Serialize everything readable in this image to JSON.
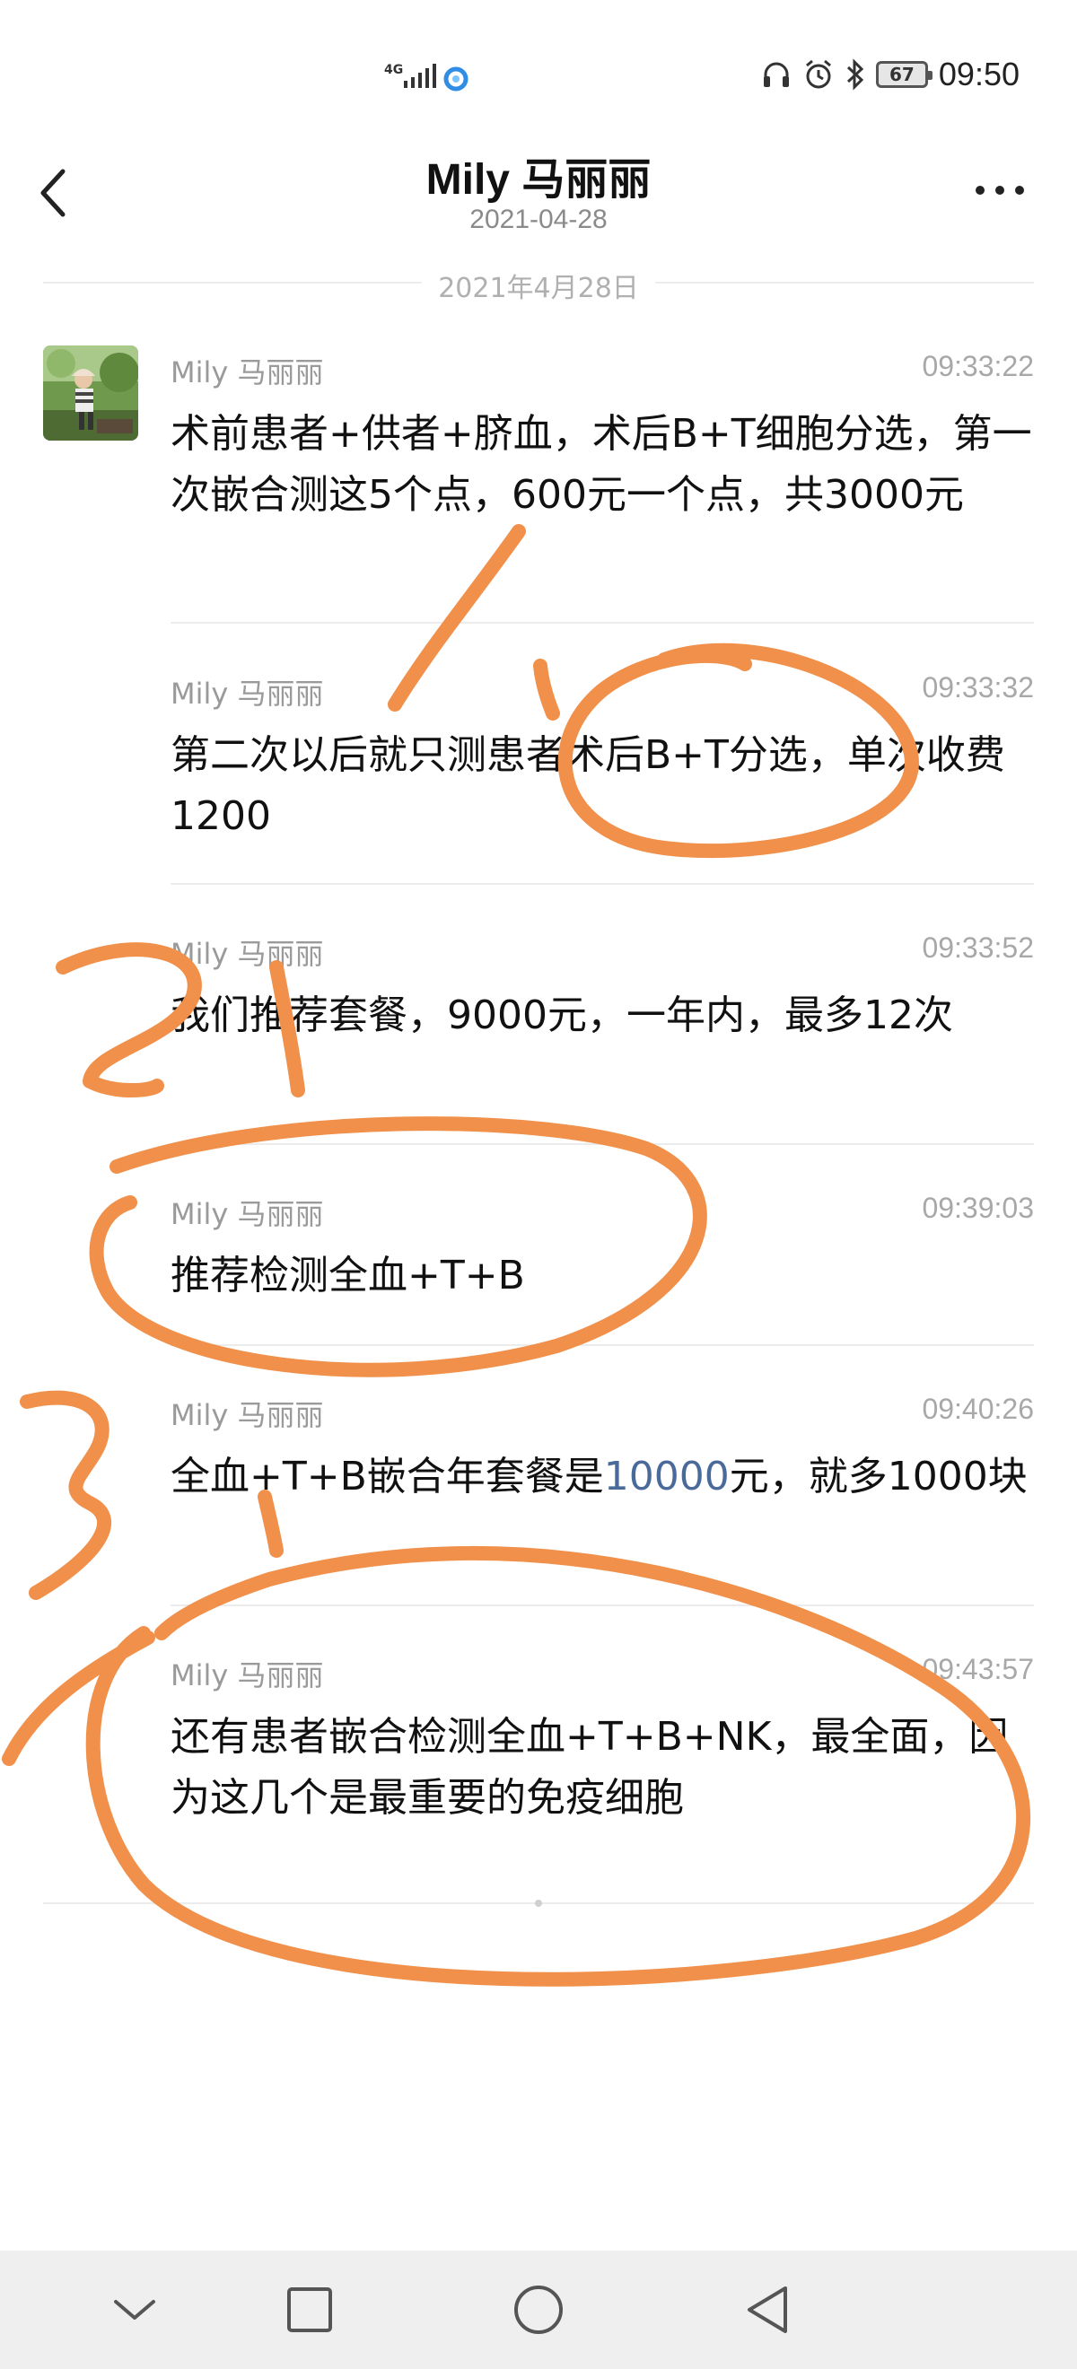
{
  "status_bar": {
    "network": "4G",
    "battery": "67",
    "time": "09:50"
  },
  "header": {
    "title": "Mily 马丽丽",
    "subtitle": "2021-04-28"
  },
  "date_divider": "2021年4月28日",
  "messages": [
    {
      "sender": "Mily 马丽丽",
      "time": "09:33:22",
      "text": "术前患者+供者+脐血，术后B+T细胞分选，第一次嵌合测这5个点，600元一个点，共3000元"
    },
    {
      "sender": "Mily 马丽丽",
      "time": "09:33:32",
      "text": "第二次以后就只测患者术后B+T分选，单次收费1200"
    },
    {
      "sender": "Mily 马丽丽",
      "time": "09:33:52",
      "text": "我们推荐套餐，9000元，一年内，最多12次"
    },
    {
      "sender": "Mily 马丽丽",
      "time": "09:39:03",
      "text": "推荐检测全血+T+B"
    },
    {
      "sender": "Mily 马丽丽",
      "time": "09:40:26",
      "text_before": "全血+T+B嵌合年套餐是",
      "text_link": "10000",
      "text_after": "元，就多1000块"
    },
    {
      "sender": "Mily 马丽丽",
      "time": "09:43:57",
      "text": "还有患者嵌合检测全血+T+B+NK，最全面，因为这几个是最重要的免疫细胞"
    }
  ],
  "annotation_color": "#f0904a",
  "nav_icons": [
    "chevron-down-icon",
    "square-icon",
    "circle-icon",
    "triangle-back-icon"
  ]
}
